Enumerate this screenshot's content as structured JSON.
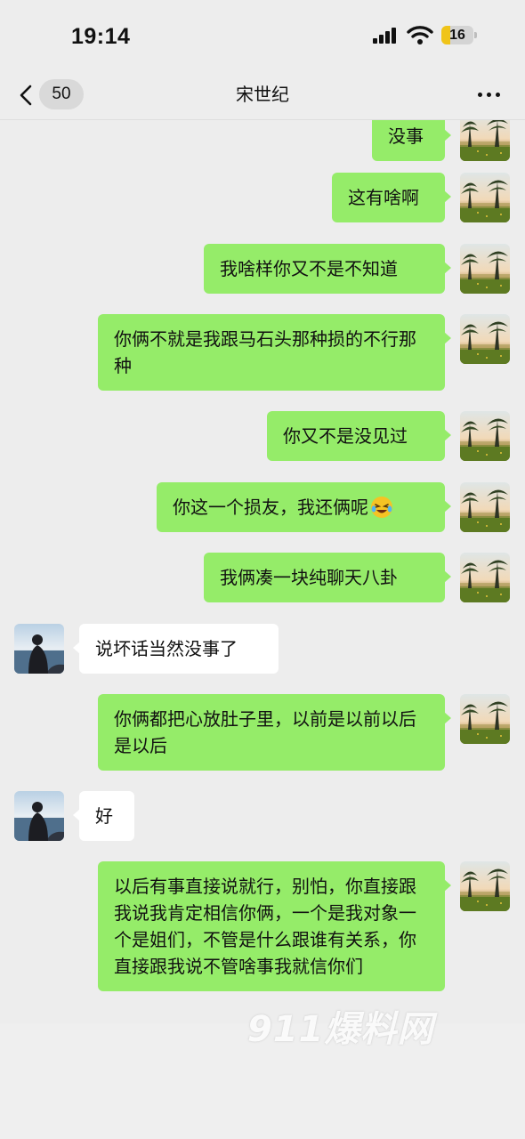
{
  "status_bar": {
    "time": "19:14",
    "battery_level": "16",
    "icons": [
      "cellular-signal-icon",
      "wifi-icon",
      "battery-icon"
    ]
  },
  "nav": {
    "unread_count": "50",
    "title": "宋世纪",
    "back_icon": "chevron-left-icon",
    "more_icon": "ellipsis-icon"
  },
  "colors": {
    "background": "#ededed",
    "sent_bubble": "#95ec69",
    "received_bubble": "#ffffff"
  },
  "messages": [
    {
      "side": "sent",
      "text": "没事"
    },
    {
      "side": "sent",
      "text": "这有啥啊"
    },
    {
      "side": "sent",
      "text": "我啥样你又不是不知道"
    },
    {
      "side": "sent",
      "text": "你俩不就是我跟马石头那种损的不行那种"
    },
    {
      "side": "sent",
      "text": "你又不是没见过"
    },
    {
      "side": "sent",
      "text": "你这一个损友，我还俩呢",
      "emoji": "laughing-crying-emoji"
    },
    {
      "side": "sent",
      "text": "我俩凑一块纯聊天八卦"
    },
    {
      "side": "received",
      "text": "说坏话当然没事了"
    },
    {
      "side": "sent",
      "text": "你俩都把心放肚子里，以前是以前以后是以后"
    },
    {
      "side": "received",
      "text": "好"
    },
    {
      "side": "sent",
      "text": "以后有事直接说就行，别怕，你直接跟我说我肯定相信你俩，一个是我对象一个是姐们，不管是什么跟谁有关系，你直接跟我说不管啥事我就信你们"
    }
  ],
  "watermark": {
    "text": "911爆料网"
  }
}
